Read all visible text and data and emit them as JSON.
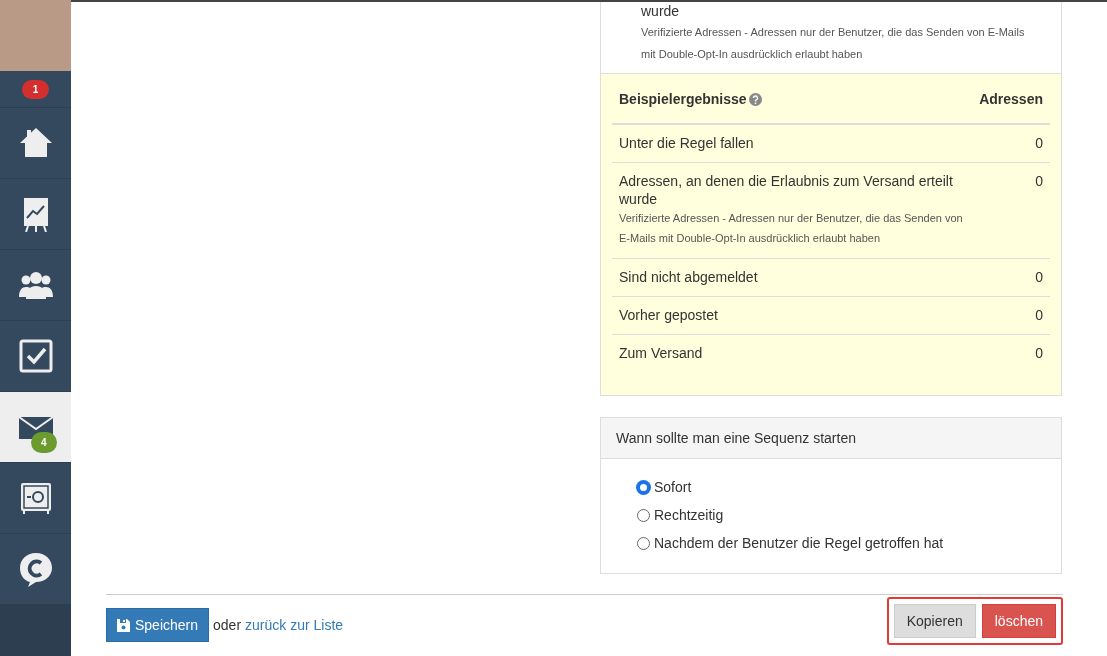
{
  "sidebar": {
    "notification_badge": "1",
    "items": [
      {
        "kind": "home",
        "selected": false
      },
      {
        "kind": "chart",
        "selected": false
      },
      {
        "kind": "users",
        "selected": false
      },
      {
        "kind": "tasks",
        "selected": false
      },
      {
        "kind": "mail",
        "selected": true,
        "badge": "4"
      },
      {
        "kind": "safe",
        "selected": false
      },
      {
        "kind": "chat",
        "selected": false
      }
    ]
  },
  "top_item": {
    "label": "wurde",
    "note": "Verifizierte Adressen - Adressen nur der Benutzer, die das Senden von E-Mails mit Double-Opt-In ausdrücklich erlaubt haben"
  },
  "results": {
    "title": "Beispielergebnisse",
    "column": "Adressen",
    "rows": [
      {
        "label": "Unter die Regel fallen",
        "value": "0"
      },
      {
        "label": "Adressen, an denen die Erlaubnis zum Versand erteilt wurde",
        "note": "Verifizierte Adressen - Adressen nur der Benutzer, die das Senden von E-Mails mit Double-Opt-In ausdrücklich erlaubt haben",
        "value": "0"
      },
      {
        "label": "Sind nicht abgemeldet",
        "value": "0"
      },
      {
        "label": "Vorher gepostet",
        "value": "0"
      },
      {
        "label": "Zum Versand",
        "value": "0"
      }
    ]
  },
  "start": {
    "title": "Wann sollte man eine Sequenz starten",
    "options": [
      {
        "label": "Sofort",
        "selected": true
      },
      {
        "label": "Rechtzeitig",
        "selected": false
      },
      {
        "label": "Nachdem der Benutzer die Regel getroffen hat",
        "selected": false
      }
    ]
  },
  "footer": {
    "save": "Speichern",
    "or": "oder",
    "back_link": "zurück zur Liste",
    "copy": "Kopieren",
    "delete": "löschen"
  }
}
